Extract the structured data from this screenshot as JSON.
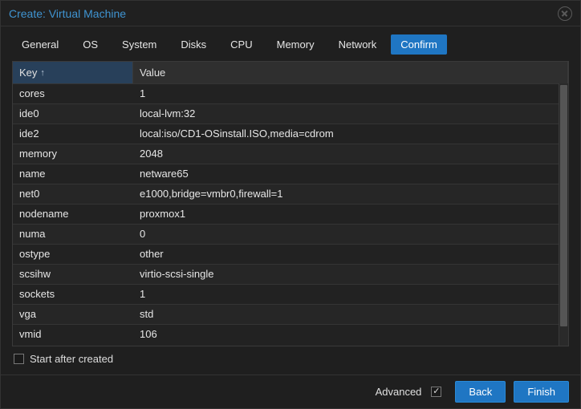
{
  "window": {
    "title": "Create: Virtual Machine"
  },
  "tabs": [
    {
      "label": "General"
    },
    {
      "label": "OS"
    },
    {
      "label": "System"
    },
    {
      "label": "Disks"
    },
    {
      "label": "CPU"
    },
    {
      "label": "Memory"
    },
    {
      "label": "Network"
    },
    {
      "label": "Confirm",
      "active": true
    }
  ],
  "columns": {
    "key": "Key",
    "value": "Value"
  },
  "rows": [
    {
      "key": "cores",
      "value": "1"
    },
    {
      "key": "ide0",
      "value": "local-lvm:32"
    },
    {
      "key": "ide2",
      "value": "local:iso/CD1-OSinstall.ISO,media=cdrom"
    },
    {
      "key": "memory",
      "value": "2048"
    },
    {
      "key": "name",
      "value": "netware65"
    },
    {
      "key": "net0",
      "value": "e1000,bridge=vmbr0,firewall=1"
    },
    {
      "key": "nodename",
      "value": "proxmox1"
    },
    {
      "key": "numa",
      "value": "0"
    },
    {
      "key": "ostype",
      "value": "other"
    },
    {
      "key": "scsihw",
      "value": "virtio-scsi-single"
    },
    {
      "key": "sockets",
      "value": "1"
    },
    {
      "key": "vga",
      "value": "std"
    },
    {
      "key": "vmid",
      "value": "106"
    }
  ],
  "start_after": {
    "label": "Start after created",
    "checked": false
  },
  "footer": {
    "advanced_label": "Advanced",
    "advanced_checked": true,
    "back": "Back",
    "finish": "Finish"
  }
}
